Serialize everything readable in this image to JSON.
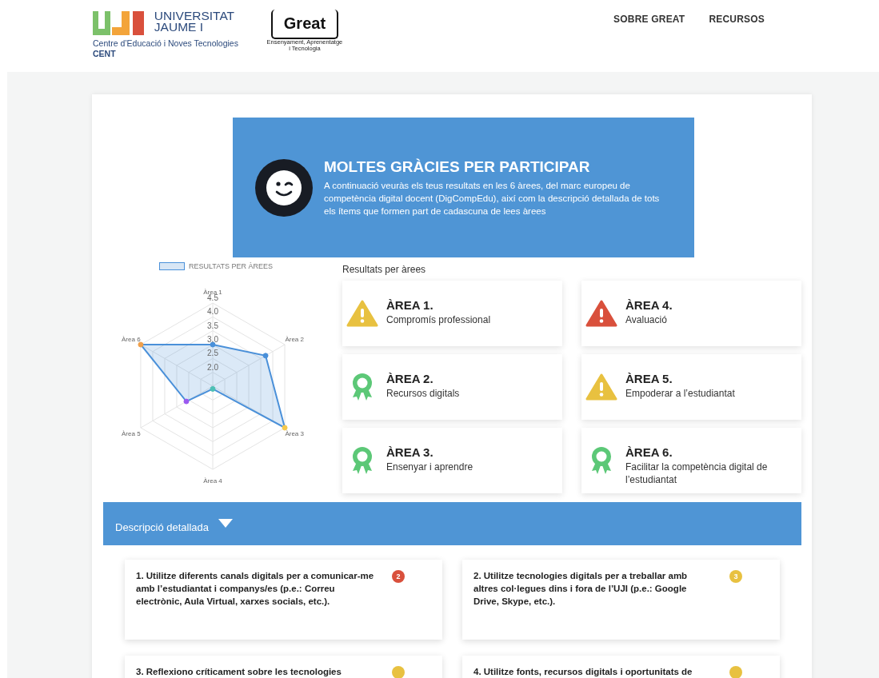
{
  "header": {
    "university": {
      "name_line1": "UNIVERSITAT",
      "name_line2": "JAUME I",
      "centre": "Centre d’Educació i Noves Tecnologies",
      "acronym": "CENT"
    },
    "great_logo": {
      "word": "Great",
      "tagline_line1": "Ensenyament, Aprenentatge",
      "tagline_line2": "i Tecnologia"
    },
    "nav": [
      {
        "label": "SOBRE GREAT"
      },
      {
        "label": "RECURSOS"
      }
    ]
  },
  "banner": {
    "title": "MOLTES GRÀCIES PER PARTICIPAR",
    "text": "A continuació veuràs els teus resultats en les 6 àrees, del marc europeu de competència digital docent (DigCompEdu), així com la descripció detallada de tots els ítems que formen part de cadascuna de lees àrees"
  },
  "chart": {
    "legend": "RESULTATS PER ÀREES",
    "axis_labels": [
      "Àrea 1",
      "Àrea 2",
      "Àrea 3",
      "Àrea 4",
      "Àrea 5",
      "Àrea 6"
    ],
    "tick_labels": [
      "4.5",
      "4.0",
      "3.5",
      "3.0",
      "2.5",
      "2.0"
    ]
  },
  "results": {
    "heading": "Resultats per àrees",
    "areas": [
      {
        "title": "ÀREA 1.",
        "name": "Compromís professional",
        "kind": "warning",
        "color": "#e8c140"
      },
      {
        "title": "ÀREA 4.",
        "name": "Avaluació",
        "kind": "warning",
        "color": "#d9503c"
      },
      {
        "title": "ÀREA 2.",
        "name": "Recursos digitals",
        "kind": "award",
        "color": "#5cc877"
      },
      {
        "title": "ÀREA 5.",
        "name": "Empoderar a l’estudiantat",
        "kind": "warning",
        "color": "#e8c140"
      },
      {
        "title": "ÀREA 3.",
        "name": "Ensenyar i aprendre",
        "kind": "award",
        "color": "#5cc877"
      },
      {
        "title": "ÀREA 6.",
        "name": "Facilitar la competència digital de l’estudiantat",
        "kind": "award",
        "color": "#5cc877"
      }
    ]
  },
  "details": {
    "label": "Descripció detallada",
    "expanded": true,
    "items": [
      {
        "text": "1. Utilitze diferents canals digitals per a comunicar-me amb l’estudiantat i companys/es (p.e.: Correu electrònic, Aula Virtual, xarxes socials, etc.).",
        "score": "2",
        "color": "#d9503c"
      },
      {
        "text": "2. Utilitze tecnologies digitals per a treballar amb altres col·legues dins i fora de l’UJI (p.e.: Google Drive, Skype, etc.).",
        "score": "3",
        "color": "#e8c140"
      },
      {
        "text": "3. Reflexiono críticament sobre les tecnologies",
        "color": "#e8c140"
      },
      {
        "text": "4. Utilitze fonts, recursos digitals i oportunitats de",
        "color": "#e8c140"
      }
    ]
  }
}
